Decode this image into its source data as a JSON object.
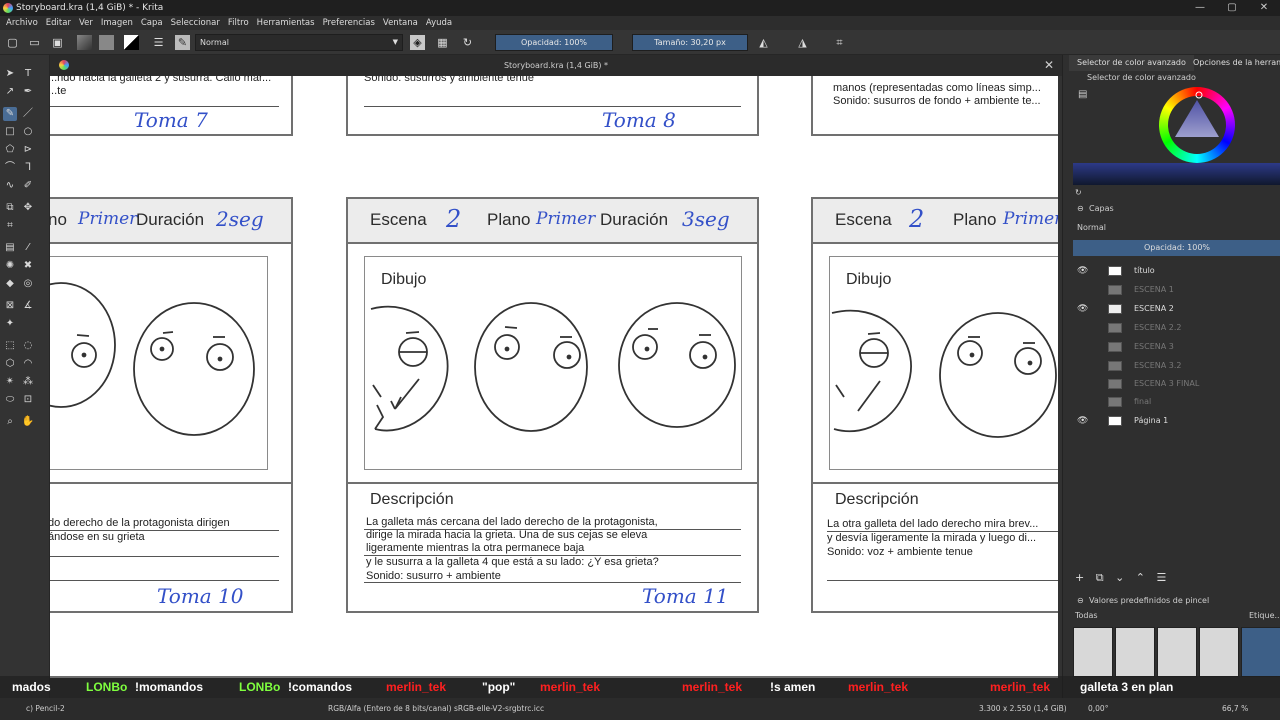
{
  "window": {
    "title": "Storyboard.kra (1,4 GiB) * - Krita",
    "min": "—",
    "max": "▢",
    "close": "✕"
  },
  "menu": [
    "Archivo",
    "Editar",
    "Ver",
    "Imagen",
    "Capa",
    "Seleccionar",
    "Filtro",
    "Herramientas",
    "Preferencias",
    "Ventana",
    "Ayuda"
  ],
  "toolbar": {
    "blend_mode": "Normal",
    "opacity": "Opacidad: 100%",
    "size": "Tamaño: 30,20 px"
  },
  "doc_tab": {
    "title": "Storyboard.kra (1,4 GiB) *",
    "close": "✕"
  },
  "storyboard": {
    "top_row": {
      "left_text": [
        "...ndo hacia la galleta 2 y susurra. Callo mar...",
        "...te"
      ],
      "left_toma": "Toma 7",
      "mid_text": "Sonido: susurros y ambiente tenue",
      "mid_toma": "Toma 8",
      "right_text": [
        "manos (representadas como líneas simp...",
        "Sonido: susurros de fondo + ambiente te..."
      ]
    },
    "cards": [
      {
        "plano_label": "no",
        "plano_value": "Primer",
        "duracion_label": "Duración",
        "duracion_value": "2seg",
        "desc_lines": [
          "do derecho de la protagonista dirigen",
          "ándose en su grieta"
        ],
        "toma": "Toma 10"
      },
      {
        "escena_label": "Escena",
        "escena_value": "2",
        "plano_label": "Plano",
        "plano_value": "Primer",
        "duracion_label": "Duración",
        "duracion_value": "3seg",
        "dibujo": "Dibujo",
        "desc_title": "Descripción",
        "desc_lines": [
          "La galleta más cercana del lado derecho de la protagonista,",
          "dirige la mirada hacia la grieta. Una de sus cejas se eleva",
          " ligeramente mientras la otra permanece baja",
          " y le susurra a la galleta 4 que está a su lado: ¿Y esa grieta?",
          "Sonido: susurro + ambiente"
        ],
        "toma": "Toma 11"
      },
      {
        "escena_label": "Escena",
        "escena_value": "2",
        "plano_label": "Plano",
        "plano_value": "Primer",
        "dibujo": "Dibujo",
        "desc_title": "Descripción",
        "desc_lines": [
          "La otra galleta del lado derecho mira brev...",
          "y desvía ligeramente la mirada y luego di...",
          "Sonido: voz + ambiente tenue"
        ]
      }
    ]
  },
  "dock": {
    "tabs": [
      "Selector de color avanzado",
      "Opciones de la herramie..."
    ],
    "color_title": "Selector de color avanzado",
    "layers_title": "Capas",
    "layer_blend": "Normal",
    "layer_opacity": "Opacidad:  100%",
    "layers": [
      {
        "name": "título",
        "visible": true
      },
      {
        "name": "ESCENA 1",
        "visible": false
      },
      {
        "name": "ESCENA 2",
        "visible": true
      },
      {
        "name": "ESCENA 2.2",
        "visible": false
      },
      {
        "name": "ESCENA 3",
        "visible": false
      },
      {
        "name": "ESCENA 3.2",
        "visible": false
      },
      {
        "name": "ESCENA 3 FINAL",
        "visible": false
      },
      {
        "name": "final",
        "visible": false
      },
      {
        "name": "Página 1",
        "visible": true
      }
    ],
    "presets_title": "Valores predefinidos de pincel",
    "presets_filter": "Todas",
    "presets_tag": "Etique..."
  },
  "chat": [
    {
      "user": "",
      "msg": "mados",
      "color": "#ffffff"
    },
    {
      "user": "LONBo",
      "msg": "!momandos",
      "color": "#7fff3f"
    },
    {
      "user": "LONBo",
      "msg": "!comandos",
      "color": "#7fff3f"
    },
    {
      "user": "merlin_tek",
      "msg": "\"pop\"",
      "color": "#ff2020"
    },
    {
      "user": "merlin_tek",
      "msg": "",
      "color": "#ff2020"
    },
    {
      "user": "merlin_tek",
      "msg": "!s amen",
      "color": "#ff2020"
    },
    {
      "user": "merlin_tek",
      "msg": "",
      "color": "#ff2020"
    },
    {
      "user": "merlin_tek",
      "msg": "galleta 3 en plan",
      "color": "#ff2020"
    }
  ],
  "status": {
    "brush": "c) Pencil-2",
    "color_space": "RGB/Alfa (Entero de 8 bits/canal)  sRGB-elle-V2-srgbtrc.icc",
    "image_size": "3.300 x 2.550 (1,4 GiB)",
    "rotation": "0,00°",
    "zoom": "66,7 %"
  }
}
